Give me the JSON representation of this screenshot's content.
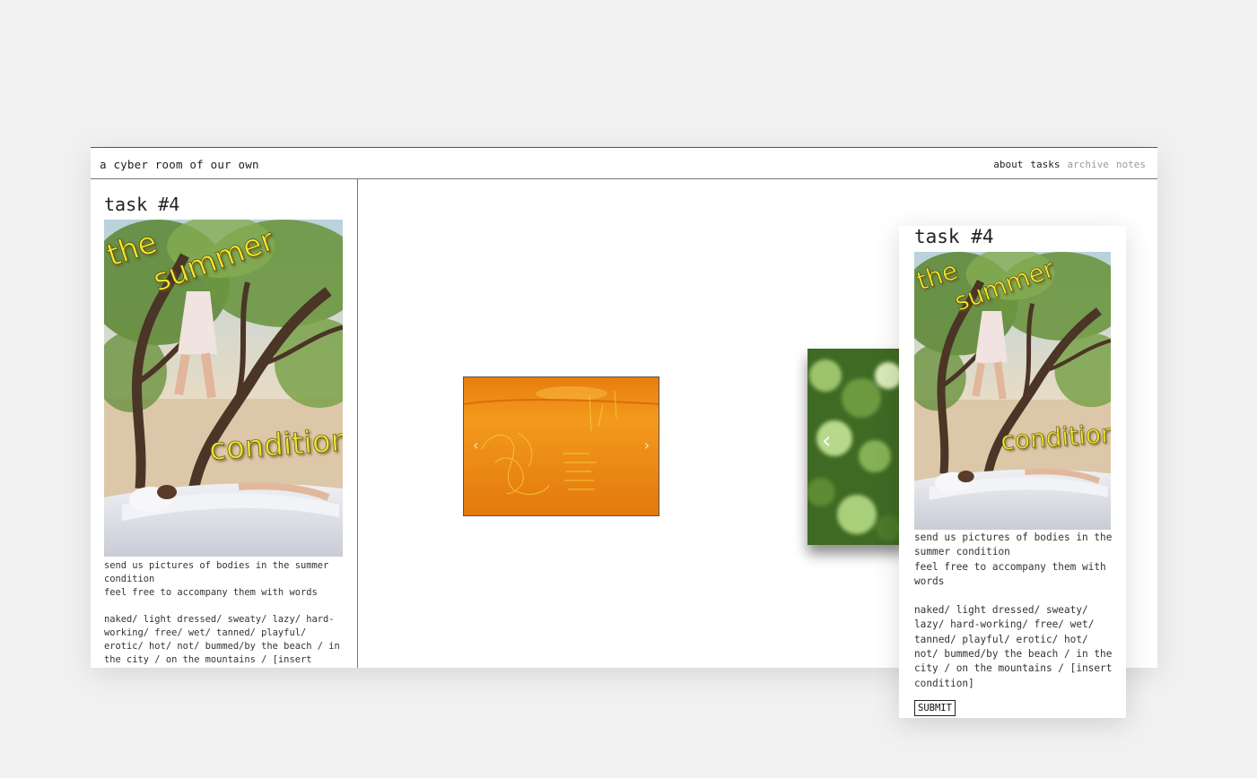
{
  "header": {
    "site_title": "a cyber room of our own",
    "nav": [
      {
        "label": "about",
        "state": "active"
      },
      {
        "label": "tasks",
        "state": "active"
      },
      {
        "label": "archive",
        "state": "muted"
      },
      {
        "label": "notes",
        "state": "muted"
      }
    ]
  },
  "task": {
    "title": "task #4",
    "poster_text": [
      "the",
      "summer",
      "condition"
    ],
    "description_lines": [
      "send us pictures of bodies in the summer condition",
      "feel free to accompany them with words"
    ],
    "conditions": "naked/ light dressed/ sweaty/ lazy/ hard-working/ free/ wet/ tanned/ playful/ erotic/ hot/ not/ bummed/by the beach / in the city / on the mountains / [insert condition]"
  },
  "carousel": {
    "prev_icon": "chevron-left-icon",
    "next_icon": "chevron-right-icon"
  },
  "popup": {
    "submit_label": "SUBMIT"
  },
  "colors": {
    "background": "#f1f1f1",
    "poster_text": "#f2e72a",
    "sunset": "#e67a0c",
    "foliage": "#4c7a2c"
  }
}
